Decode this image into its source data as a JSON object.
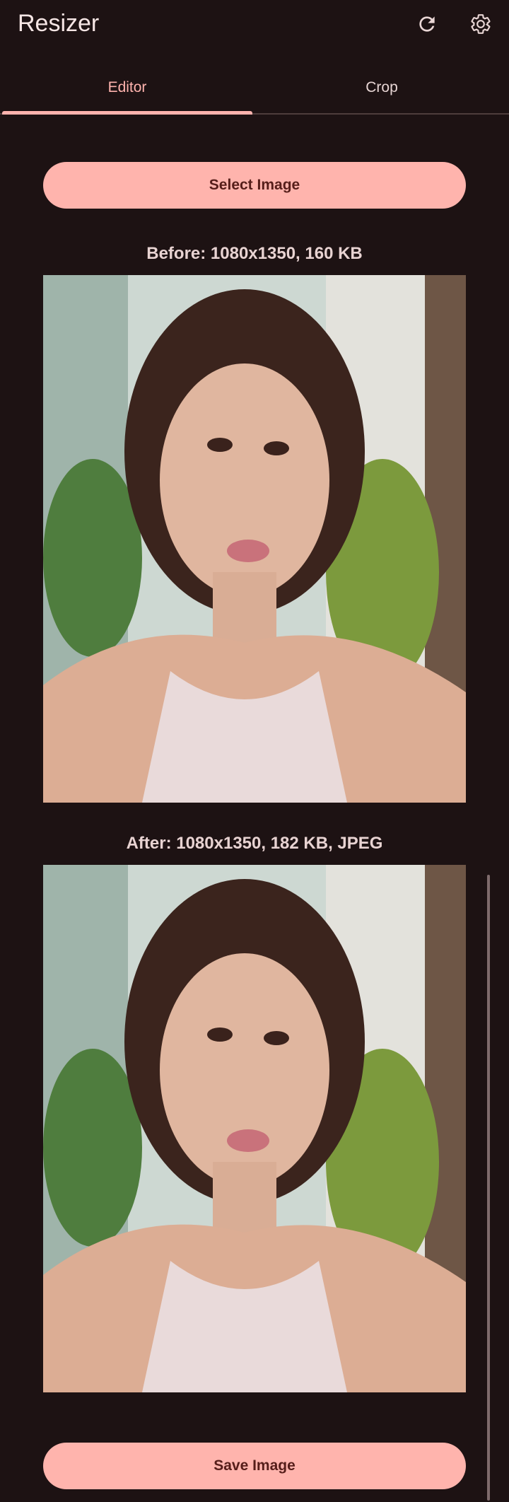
{
  "app": {
    "title": "Resizer",
    "refresh_icon": "refresh-icon",
    "settings_icon": "gear-icon"
  },
  "tabs": [
    {
      "label": "Editor",
      "active": true
    },
    {
      "label": "Crop",
      "active": false
    }
  ],
  "actions": {
    "select_label": "Select Image",
    "save_label": "Save Image"
  },
  "before": {
    "caption": "Before: 1080x1350, 160 KB"
  },
  "after": {
    "caption": "After: 1080x1350, 182 KB, JPEG"
  },
  "colors": {
    "background": "#1d1213",
    "accent": "#ffb4ad",
    "on_accent": "#561e1a"
  }
}
